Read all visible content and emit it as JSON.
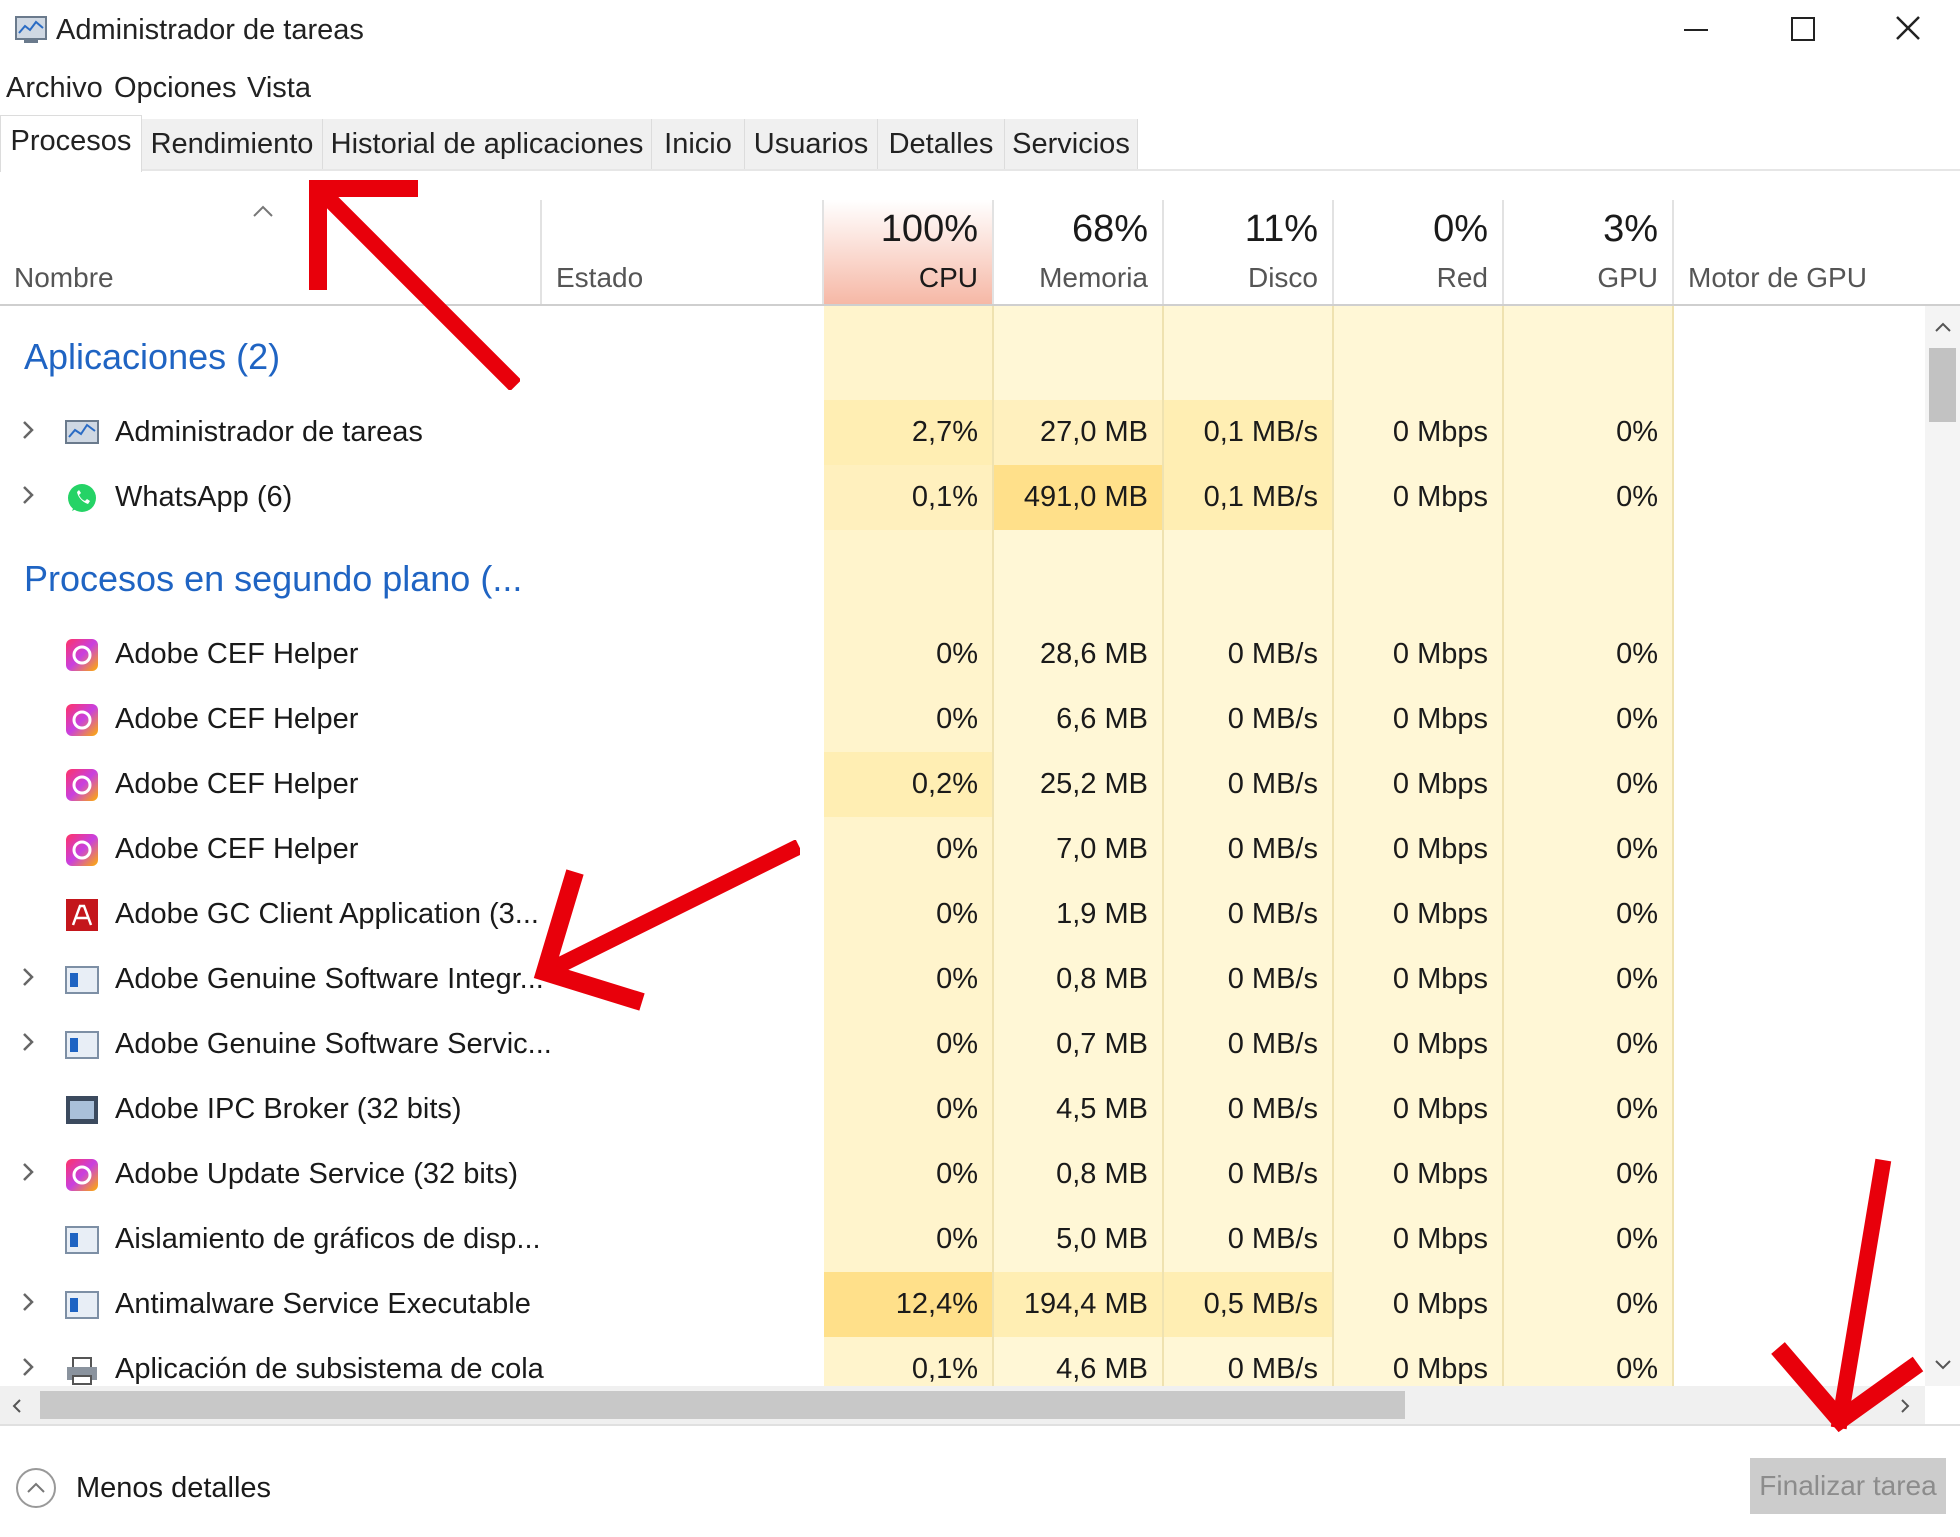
{
  "window": {
    "title": "Administrador de tareas"
  },
  "menu": [
    "Archivo",
    "Opciones",
    "Vista"
  ],
  "tabs": [
    "Procesos",
    "Rendimiento",
    "Historial de aplicaciones",
    "Inicio",
    "Usuarios",
    "Detalles",
    "Servicios"
  ],
  "active_tab": "Procesos",
  "columns": {
    "name": "Nombre",
    "status": "Estado",
    "cpu": {
      "pct": "100%",
      "label": "CPU"
    },
    "memory": {
      "pct": "68%",
      "label": "Memoria"
    },
    "disk": {
      "pct": "11%",
      "label": "Disco"
    },
    "network": {
      "pct": "0%",
      "label": "Red"
    },
    "gpu": {
      "pct": "3%",
      "label": "GPU"
    },
    "gpu_engine": "Motor de GPU"
  },
  "groups": {
    "apps": "Aplicaciones (2)",
    "background": "Procesos en segundo plano (..."
  },
  "apps": [
    {
      "name": "Administrador de tareas",
      "cpu": "2,7%",
      "mem": "27,0 MB",
      "disk": "0,1 MB/s",
      "net": "0 Mbps",
      "gpu": "0%"
    },
    {
      "name": "WhatsApp (6)",
      "cpu": "0,1%",
      "mem": "491,0 MB",
      "disk": "0,1 MB/s",
      "net": "0 Mbps",
      "gpu": "0%"
    }
  ],
  "background": [
    {
      "name": "Adobe CEF Helper",
      "cpu": "0%",
      "mem": "28,6 MB",
      "disk": "0 MB/s",
      "net": "0 Mbps",
      "gpu": "0%"
    },
    {
      "name": "Adobe CEF Helper",
      "cpu": "0%",
      "mem": "6,6 MB",
      "disk": "0 MB/s",
      "net": "0 Mbps",
      "gpu": "0%"
    },
    {
      "name": "Adobe CEF Helper",
      "cpu": "0,2%",
      "mem": "25,2 MB",
      "disk": "0 MB/s",
      "net": "0 Mbps",
      "gpu": "0%"
    },
    {
      "name": "Adobe CEF Helper",
      "cpu": "0%",
      "mem": "7,0 MB",
      "disk": "0 MB/s",
      "net": "0 Mbps",
      "gpu": "0%"
    },
    {
      "name": "Adobe GC Client Application (3...",
      "cpu": "0%",
      "mem": "1,9 MB",
      "disk": "0 MB/s",
      "net": "0 Mbps",
      "gpu": "0%"
    },
    {
      "name": "Adobe Genuine Software Integr...",
      "cpu": "0%",
      "mem": "0,8 MB",
      "disk": "0 MB/s",
      "net": "0 Mbps",
      "gpu": "0%"
    },
    {
      "name": "Adobe Genuine Software Servic...",
      "cpu": "0%",
      "mem": "0,7 MB",
      "disk": "0 MB/s",
      "net": "0 Mbps",
      "gpu": "0%"
    },
    {
      "name": "Adobe IPC Broker (32 bits)",
      "cpu": "0%",
      "mem": "4,5 MB",
      "disk": "0 MB/s",
      "net": "0 Mbps",
      "gpu": "0%"
    },
    {
      "name": "Adobe Update Service (32 bits)",
      "cpu": "0%",
      "mem": "0,8 MB",
      "disk": "0 MB/s",
      "net": "0 Mbps",
      "gpu": "0%"
    },
    {
      "name": "Aislamiento de gráficos de disp...",
      "cpu": "0%",
      "mem": "5,0 MB",
      "disk": "0 MB/s",
      "net": "0 Mbps",
      "gpu": "0%"
    },
    {
      "name": "Antimalware Service Executable",
      "cpu": "12,4%",
      "mem": "194,4 MB",
      "disk": "0,5 MB/s",
      "net": "0 Mbps",
      "gpu": "0%"
    },
    {
      "name": "Aplicación de subsistema de cola",
      "cpu": "0,1%",
      "mem": "4,6 MB",
      "disk": "0 MB/s",
      "net": "0 Mbps",
      "gpu": "0%"
    }
  ],
  "footer": {
    "less_details": "Menos detalles",
    "end_task": "Finalizar tarea"
  },
  "colors": {
    "accent_blue": "#1f64c3",
    "cpu_header_hot": "#f6b8a6",
    "cell_light": "#fff7d6",
    "cell_mid": "#ffeeb3",
    "cell_hot": "#ffe08a",
    "annotation_red": "#e8000b"
  }
}
